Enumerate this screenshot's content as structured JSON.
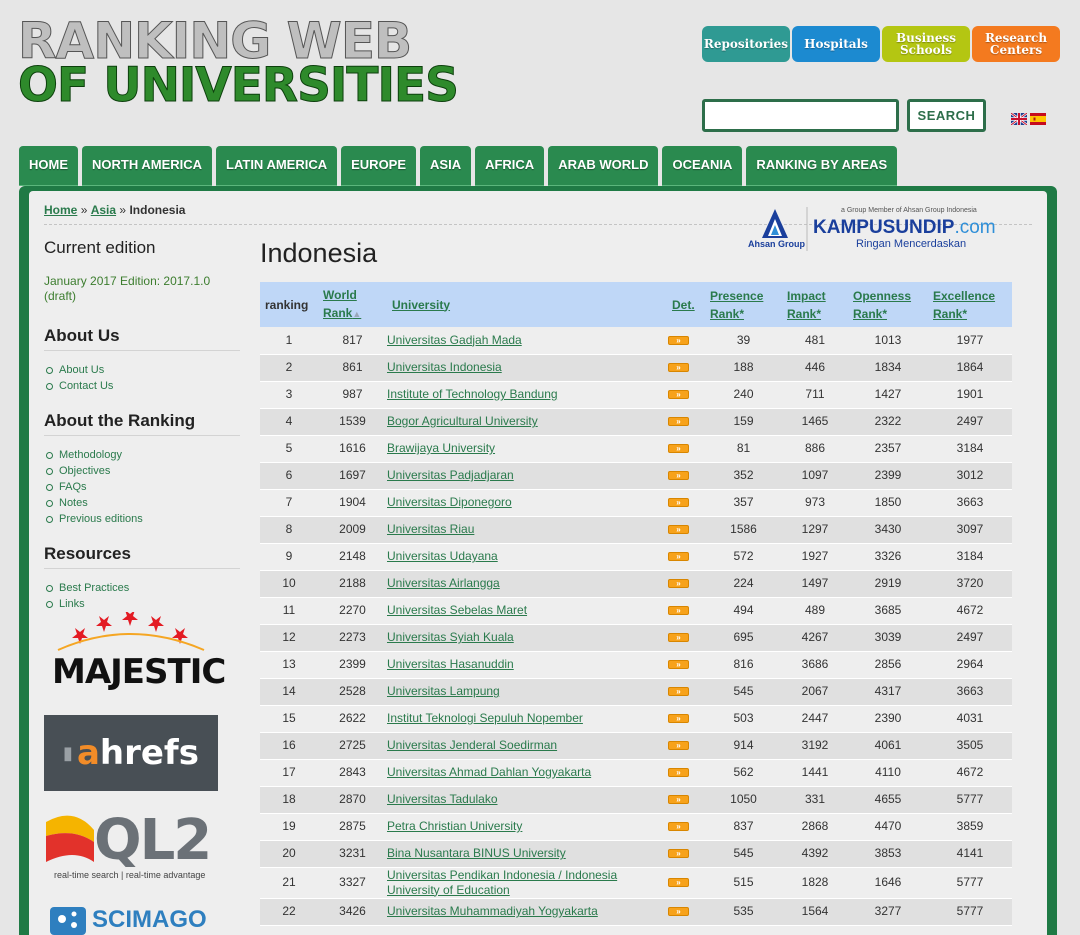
{
  "header": {
    "logo_line1": "RANKING WEB",
    "logo_line2": "OF UNIVERSITIES",
    "top_buttons": [
      {
        "label": "Repositories",
        "color": "#2f9a93"
      },
      {
        "label": "Hospitals",
        "color": "#1c8ad0"
      },
      {
        "label": "Business Schools",
        "color": "#b4c612"
      },
      {
        "label": "Research Centers",
        "color": "#f47a1f"
      }
    ],
    "search_value": "",
    "search_button": "SEARCH",
    "flags": [
      "english-flag-icon",
      "spanish-flag-icon"
    ]
  },
  "nav": [
    "HOME",
    "NORTH AMERICA",
    "LATIN AMERICA",
    "EUROPE",
    "ASIA",
    "AFRICA",
    "ARAB WORLD",
    "OCEANIA",
    "RANKING BY AREAS"
  ],
  "breadcrumb": {
    "home": "Home",
    "sep": "»",
    "asia": "Asia",
    "current": "Indonesia"
  },
  "sidebar": {
    "current_edition_title": "Current edition",
    "edition_text": "January 2017 Edition: 2017.1.0 (draft)",
    "about_us_title": "About Us",
    "about_us_links": [
      "About Us",
      "Contact Us"
    ],
    "about_ranking_title": "About the Ranking",
    "about_ranking_links": [
      "Methodology",
      "Objectives",
      "FAQs",
      "Notes",
      "Previous editions"
    ],
    "resources_title": "Resources",
    "resources_links": [
      "Best Practices",
      "Links"
    ],
    "logos": {
      "majestic": "MAJESTIC",
      "ahrefs_a": "a",
      "ahrefs_rest": "hrefs",
      "ql2": "QL2",
      "ql2_tag": "real-time search | real-time advantage",
      "scimago": "SCIMAGO"
    }
  },
  "sponsor": {
    "group_note": "a Group Member of Ahsan Group Indonesia",
    "ahsan": "Ahsan Group",
    "brand": "KAMPUSUNDIP",
    "brand_tld": ".com",
    "tagline": "Ringan Mencerdaskan"
  },
  "main": {
    "title": "Indonesia",
    "columns": {
      "ranking": "ranking",
      "world_rank_1": "World",
      "world_rank_2": "Rank",
      "university": "University",
      "det": "Det.",
      "presence_1": "Presence",
      "presence_2": "Rank*",
      "impact_1": "Impact",
      "impact_2": "Rank*",
      "openness_1": "Openness",
      "openness_2": "Rank*",
      "excellence_1": "Excellence",
      "excellence_2": "Rank*"
    },
    "det_glyph": "»",
    "rows": [
      {
        "rank": "1",
        "world": "817",
        "name": "Universitas Gadjah Mada",
        "presence": "39",
        "impact": "481",
        "openness": "1013",
        "excellence": "1977"
      },
      {
        "rank": "2",
        "world": "861",
        "name": "Universitas Indonesia",
        "presence": "188",
        "impact": "446",
        "openness": "1834",
        "excellence": "1864"
      },
      {
        "rank": "3",
        "world": "987",
        "name": "Institute of Technology Bandung",
        "presence": "240",
        "impact": "711",
        "openness": "1427",
        "excellence": "1901"
      },
      {
        "rank": "4",
        "world": "1539",
        "name": "Bogor Agricultural University",
        "presence": "159",
        "impact": "1465",
        "openness": "2322",
        "excellence": "2497"
      },
      {
        "rank": "5",
        "world": "1616",
        "name": "Brawijaya University",
        "presence": "81",
        "impact": "886",
        "openness": "2357",
        "excellence": "3184"
      },
      {
        "rank": "6",
        "world": "1697",
        "name": "Universitas Padjadjaran",
        "presence": "352",
        "impact": "1097",
        "openness": "2399",
        "excellence": "3012"
      },
      {
        "rank": "7",
        "world": "1904",
        "name": "Universitas Diponegoro",
        "presence": "357",
        "impact": "973",
        "openness": "1850",
        "excellence": "3663"
      },
      {
        "rank": "8",
        "world": "2009",
        "name": "Universitas Riau",
        "presence": "1586",
        "impact": "1297",
        "openness": "3430",
        "excellence": "3097"
      },
      {
        "rank": "9",
        "world": "2148",
        "name": "Universitas Udayana",
        "presence": "572",
        "impact": "1927",
        "openness": "3326",
        "excellence": "3184"
      },
      {
        "rank": "10",
        "world": "2188",
        "name": "Universitas Airlangga",
        "presence": "224",
        "impact": "1497",
        "openness": "2919",
        "excellence": "3720"
      },
      {
        "rank": "11",
        "world": "2270",
        "name": "Universitas Sebelas Maret",
        "presence": "494",
        "impact": "489",
        "openness": "3685",
        "excellence": "4672"
      },
      {
        "rank": "12",
        "world": "2273",
        "name": "Universitas Syiah Kuala",
        "presence": "695",
        "impact": "4267",
        "openness": "3039",
        "excellence": "2497"
      },
      {
        "rank": "13",
        "world": "2399",
        "name": "Universitas Hasanuddin",
        "presence": "816",
        "impact": "3686",
        "openness": "2856",
        "excellence": "2964"
      },
      {
        "rank": "14",
        "world": "2528",
        "name": "Universitas Lampung",
        "presence": "545",
        "impact": "2067",
        "openness": "4317",
        "excellence": "3663"
      },
      {
        "rank": "15",
        "world": "2622",
        "name": "Institut Teknologi Sepuluh Nopember",
        "presence": "503",
        "impact": "2447",
        "openness": "2390",
        "excellence": "4031"
      },
      {
        "rank": "16",
        "world": "2725",
        "name": "Universitas Jenderal Soedirman",
        "presence": "914",
        "impact": "3192",
        "openness": "4061",
        "excellence": "3505"
      },
      {
        "rank": "17",
        "world": "2843",
        "name": "Universitas Ahmad Dahlan Yogyakarta",
        "presence": "562",
        "impact": "1441",
        "openness": "4110",
        "excellence": "4672"
      },
      {
        "rank": "18",
        "world": "2870",
        "name": "Universitas Tadulako",
        "presence": "1050",
        "impact": "331",
        "openness": "4655",
        "excellence": "5777"
      },
      {
        "rank": "19",
        "world": "2875",
        "name": "Petra Christian University",
        "presence": "837",
        "impact": "2868",
        "openness": "4470",
        "excellence": "3859"
      },
      {
        "rank": "20",
        "world": "3231",
        "name": "Bina Nusantara BINUS University",
        "presence": "545",
        "impact": "4392",
        "openness": "3853",
        "excellence": "4141"
      },
      {
        "rank": "21",
        "world": "3327",
        "name": "Universitas Pendikan Indonesia / Indonesia University of Education",
        "presence": "515",
        "impact": "1828",
        "openness": "1646",
        "excellence": "5777"
      },
      {
        "rank": "22",
        "world": "3426",
        "name": "Universitas Muhammadiyah Yogyakarta",
        "presence": "535",
        "impact": "1564",
        "openness": "3277",
        "excellence": "5777"
      }
    ]
  }
}
